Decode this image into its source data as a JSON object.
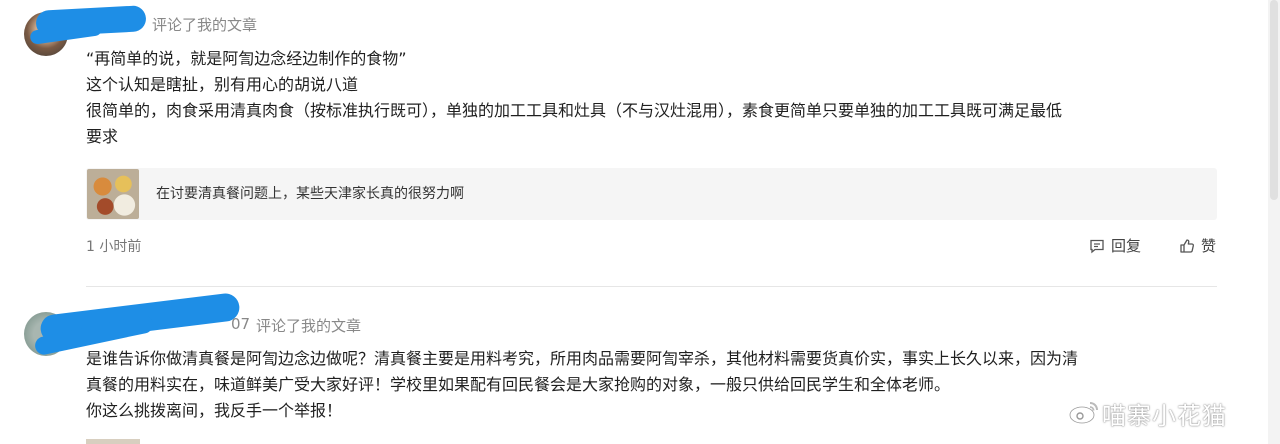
{
  "comments": [
    {
      "meta_suffix": "评论了我的文章",
      "lines": [
        "“再简单的说，就是阿訇边念经边制作的食物”",
        "这个认知是瞎扯，别有用心的胡说八道",
        "很简单的，肉食采用清真肉食（按标准执行既可），单独的加工工具和灶具（不与汉灶混用），素食更简单只要单独的加工工具既可满足最低",
        "要求"
      ],
      "quote_text": "在讨要清真餐问题上，某些天津家长真的很努力啊",
      "time": "1 小时前",
      "reply_label": "回复",
      "like_label": "赞"
    },
    {
      "meta_prefix": "07",
      "meta_suffix": "评论了我的文章",
      "lines": [
        "是谁告诉你做清真餐是阿訇边念边做呢？清真餐主要是用料考究，所用肉品需要阿訇宰杀，其他材料需要货真价实，事实上长久以来，因为清",
        "真餐的用料实在，味道鲜美广受大家好评！学校里如果配有回民餐会是大家抢购的对象，一般只供给回民学生和全体老师。",
        "你这么挑拨离间，我反手一个举报！"
      ]
    }
  ],
  "watermark": "喵寨小花猫",
  "colors": {
    "redaction": "#1e8ee6",
    "meta": "#888888",
    "card_bg": "#f5f5f5"
  }
}
